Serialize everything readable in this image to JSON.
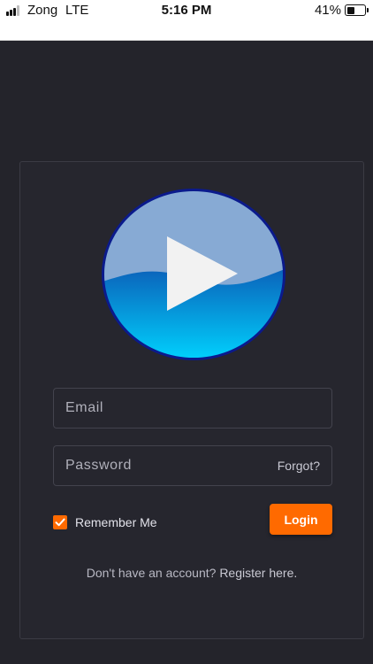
{
  "status_bar": {
    "carrier": "Zong",
    "network": "LTE",
    "time": "5:16 PM",
    "battery": "41%"
  },
  "logo": {
    "icon": "play-button-icon"
  },
  "form": {
    "email_placeholder": "Email",
    "password_placeholder": "Password",
    "forgot_label": "Forgot?",
    "remember_label": "Remember Me",
    "remember_checked": true,
    "login_label": "Login"
  },
  "footer": {
    "prompt": "Don't have an account?",
    "register_link": "Register here."
  },
  "colors": {
    "accent": "#ff6a00",
    "background": "#24242b",
    "card": "#26262e"
  }
}
